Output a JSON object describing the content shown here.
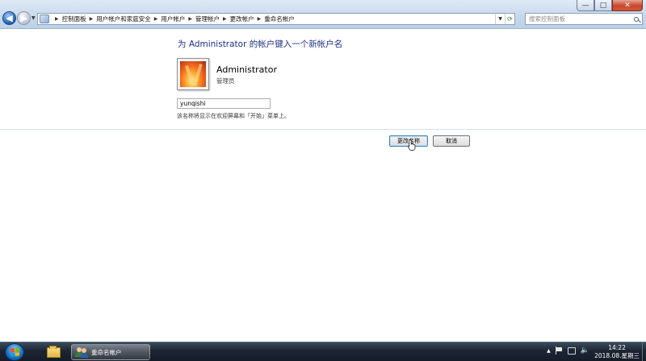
{
  "window": {
    "minimize_glyph": "—",
    "maximize_glyph": "□",
    "close_glyph": "✕"
  },
  "nav": {
    "back_glyph": "◀",
    "forward_glyph": "▶",
    "recent_glyph": "▼"
  },
  "breadcrumb": {
    "separator": "▶",
    "items": [
      "控制面板",
      "用户帐户和家庭安全",
      "用户帐户",
      "管理帐户",
      "更改帐户",
      "重命名帐户"
    ]
  },
  "search": {
    "placeholder": "搜索控制面板"
  },
  "main": {
    "heading": "为 Administrator 的帐户键入一个新帐户名",
    "account_name": "Administrator",
    "account_role": "管理员",
    "new_name_value": "yunqishi",
    "note": "该名称将显示在欢迎屏幕和「开始」菜单上。",
    "change_name_button": "更改名称",
    "cancel_button": "取消"
  },
  "taskbar": {
    "active_window_label": "重命名帐户",
    "time": "14:22",
    "date": "2018.08.星期三"
  },
  "colors": {
    "heading": "#1e3287",
    "chrome": "#c7d8ec",
    "taskbar": "#1c2633"
  }
}
